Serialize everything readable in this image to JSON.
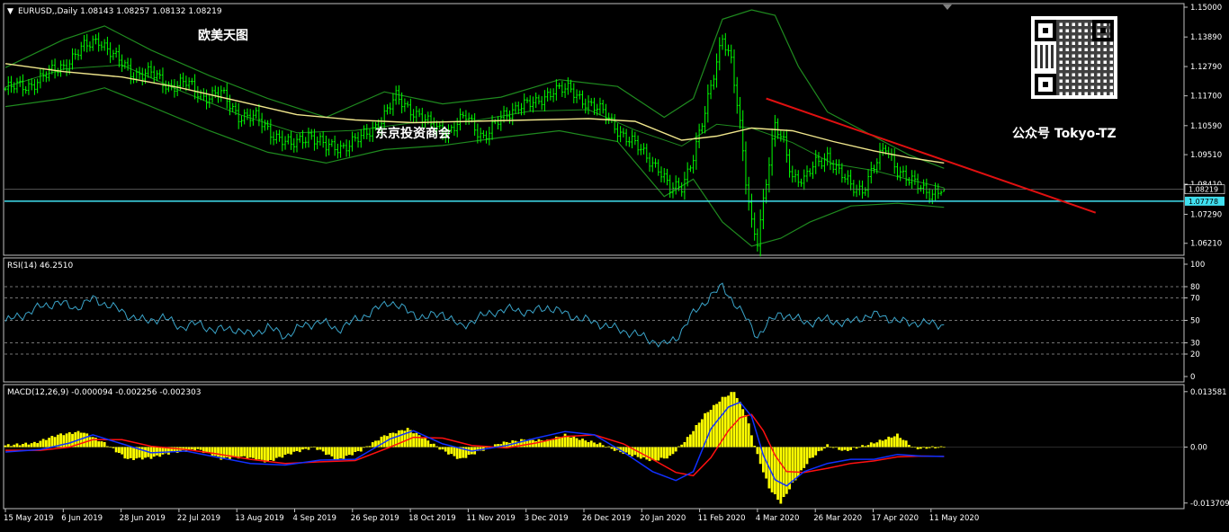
{
  "header": {
    "symbol_line": "EURUSD,,Daily  1.08143 1.08257 1.08132 1.08219"
  },
  "watermarks": {
    "top_left": "欧美天图",
    "middle": "东京投资商会",
    "right": "公众号 Tokyo-TZ"
  },
  "colors": {
    "background": "#000000",
    "candle": "#00ff00",
    "bollinger": "#1f8a1f",
    "ma": "#f0e68c",
    "trendline": "#e01010",
    "support": "#40e0f0",
    "rsi": "#3aa3c8",
    "macd_hist": "#ffff00",
    "macd_line": "#1030ff",
    "signal_line": "#ff1010",
    "grid": "#c0c0c0"
  },
  "chart_data": [
    {
      "type": "candlestick",
      "title": "EURUSD,,Daily",
      "ohlc_last": {
        "open": 1.08143,
        "high": 1.08257,
        "low": 1.08132,
        "close": 1.08219
      },
      "price_ticks": [
        "1.15000",
        "1.13890",
        "1.12790",
        "1.11700",
        "1.10590",
        "1.09510",
        "1.08410",
        "1.07290",
        "1.06210"
      ],
      "ylim": [
        1.058,
        1.151
      ],
      "current_price": "1.08219",
      "support_level": "1.07778",
      "overlays": [
        "Bollinger Bands",
        "Moving Average",
        "Trendline",
        "Horizontal line"
      ],
      "x_dates": [
        "15 May 2019",
        "6 Jun 2019",
        "28 Jun 2019",
        "22 Jul 2019",
        "13 Aug 2019",
        "4 Sep 2019",
        "26 Sep 2019",
        "18 Oct 2019",
        "11 Nov 2019",
        "3 Dec 2019",
        "26 Dec 2019",
        "20 Jan 2020",
        "11 Feb 2020",
        "4 Mar 2020",
        "26 Mar 2020",
        "17 Apr 2020",
        "11 May 2020"
      ],
      "close_path": [
        [
          0,
          1.1195
        ],
        [
          8,
          1.121
        ],
        [
          14,
          1.1245
        ],
        [
          20,
          1.1285
        ],
        [
          26,
          1.134
        ],
        [
          32,
          1.1385
        ],
        [
          38,
          1.1305
        ],
        [
          44,
          1.1255
        ],
        [
          50,
          1.125
        ],
        [
          56,
          1.121
        ],
        [
          62,
          1.1215
        ],
        [
          68,
          1.117
        ],
        [
          74,
          1.1175
        ],
        [
          80,
          1.11
        ],
        [
          86,
          1.1085
        ],
        [
          92,
          1.103
        ],
        [
          98,
          1.098
        ],
        [
          104,
          1.103
        ],
        [
          110,
          1.0975
        ],
        [
          116,
          1.0985
        ],
        [
          122,
          1.101
        ],
        [
          128,
          1.107
        ],
        [
          134,
          1.116
        ],
        [
          140,
          1.1115
        ],
        [
          146,
          1.1055
        ],
        [
          152,
          1.104
        ],
        [
          158,
          1.109
        ],
        [
          164,
          1.102
        ],
        [
          170,
          1.108
        ],
        [
          176,
          1.114
        ],
        [
          182,
          1.1135
        ],
        [
          188,
          1.12
        ],
        [
          194,
          1.1185
        ],
        [
          200,
          1.1145
        ],
        [
          206,
          1.1095
        ],
        [
          212,
          1.1025
        ],
        [
          218,
          1.0965
        ],
        [
          224,
          1.0905
        ],
        [
          228,
          1.0815
        ],
        [
          232,
          1.0835
        ],
        [
          236,
          1.095
        ],
        [
          240,
          1.11
        ],
        [
          243,
          1.125
        ],
        [
          246,
          1.14
        ],
        [
          249,
          1.13
        ],
        [
          252,
          1.105
        ],
        [
          254,
          1.085
        ],
        [
          256,
          1.07
        ],
        [
          258,
          1.064
        ],
        [
          261,
          1.085
        ],
        [
          264,
          1.105
        ],
        [
          267,
          1.1
        ],
        [
          270,
          1.0875
        ],
        [
          274,
          1.085
        ],
        [
          278,
          1.092
        ],
        [
          282,
          1.095
        ],
        [
          286,
          1.088
        ],
        [
          290,
          1.0835
        ],
        [
          294,
          1.0825
        ],
        [
          298,
          1.09
        ],
        [
          302,
          1.098
        ],
        [
          306,
          1.09
        ],
        [
          310,
          1.085
        ],
        [
          314,
          1.083
        ],
        [
          318,
          1.081
        ],
        [
          322,
          1.0822
        ]
      ],
      "bands_upper_path": [
        [
          0,
          1.1275
        ],
        [
          20,
          1.138
        ],
        [
          34,
          1.143
        ],
        [
          50,
          1.134
        ],
        [
          70,
          1.1245
        ],
        [
          90,
          1.116
        ],
        [
          110,
          1.109
        ],
        [
          130,
          1.1185
        ],
        [
          150,
          1.114
        ],
        [
          170,
          1.1165
        ],
        [
          190,
          1.123
        ],
        [
          210,
          1.1205
        ],
        [
          226,
          1.109
        ],
        [
          236,
          1.116
        ],
        [
          246,
          1.1455
        ],
        [
          256,
          1.149
        ],
        [
          264,
          1.147
        ],
        [
          272,
          1.128
        ],
        [
          282,
          1.111
        ],
        [
          296,
          1.103
        ],
        [
          310,
          1.095
        ],
        [
          322,
          1.09
        ]
      ],
      "bands_lower_path": [
        [
          0,
          1.113
        ],
        [
          20,
          1.116
        ],
        [
          34,
          1.12
        ],
        [
          50,
          1.113
        ],
        [
          70,
          1.104
        ],
        [
          90,
          1.096
        ],
        [
          110,
          1.092
        ],
        [
          130,
          1.097
        ],
        [
          150,
          1.0985
        ],
        [
          170,
          1.1015
        ],
        [
          190,
          1.104
        ],
        [
          210,
          1.1
        ],
        [
          226,
          1.0795
        ],
        [
          236,
          1.086
        ],
        [
          246,
          1.07
        ],
        [
          256,
          1.061
        ],
        [
          266,
          1.064
        ],
        [
          276,
          1.07
        ],
        [
          290,
          1.076
        ],
        [
          306,
          1.077
        ],
        [
          322,
          1.0755
        ]
      ],
      "ma_path": [
        [
          0,
          1.129
        ],
        [
          20,
          1.126
        ],
        [
          40,
          1.124
        ],
        [
          60,
          1.12
        ],
        [
          80,
          1.115
        ],
        [
          100,
          1.11
        ],
        [
          120,
          1.108
        ],
        [
          140,
          1.107
        ],
        [
          160,
          1.1075
        ],
        [
          180,
          1.108
        ],
        [
          200,
          1.1085
        ],
        [
          216,
          1.1075
        ],
        [
          232,
          1.1005
        ],
        [
          244,
          1.102
        ],
        [
          256,
          1.105
        ],
        [
          270,
          1.104
        ],
        [
          284,
          1.1
        ],
        [
          298,
          1.0965
        ],
        [
          310,
          1.094
        ],
        [
          322,
          1.092
        ]
      ],
      "trendline": [
        [
          261,
          1.116
        ],
        [
          374,
          1.0735
        ]
      ]
    },
    {
      "type": "line",
      "title": "RSI(14) 46.2510",
      "indicator": "RSI(14)",
      "last_value": 46.251,
      "ylim": [
        0,
        100
      ],
      "levels": [
        20,
        30,
        50,
        70,
        80
      ],
      "tick_labels": [
        "100",
        "80",
        "70",
        "50",
        "30",
        "20",
        "0"
      ],
      "values": [
        [
          0,
          49
        ],
        [
          6,
          55
        ],
        [
          12,
          62
        ],
        [
          18,
          66
        ],
        [
          24,
          61
        ],
        [
          30,
          69
        ],
        [
          36,
          63
        ],
        [
          42,
          55
        ],
        [
          48,
          49
        ],
        [
          54,
          53
        ],
        [
          60,
          44
        ],
        [
          66,
          47
        ],
        [
          72,
          41
        ],
        [
          78,
          43
        ],
        [
          84,
          37
        ],
        [
          90,
          44
        ],
        [
          96,
          36
        ],
        [
          102,
          45
        ],
        [
          108,
          49
        ],
        [
          114,
          42
        ],
        [
          120,
          50
        ],
        [
          126,
          58
        ],
        [
          132,
          67
        ],
        [
          138,
          58
        ],
        [
          144,
          52
        ],
        [
          150,
          57
        ],
        [
          156,
          44
        ],
        [
          162,
          52
        ],
        [
          168,
          58
        ],
        [
          174,
          60
        ],
        [
          180,
          57
        ],
        [
          186,
          62
        ],
        [
          192,
          56
        ],
        [
          198,
          51
        ],
        [
          204,
          47
        ],
        [
          210,
          42
        ],
        [
          216,
          38
        ],
        [
          222,
          32
        ],
        [
          226,
          28
        ],
        [
          230,
          34
        ],
        [
          236,
          56
        ],
        [
          242,
          72
        ],
        [
          246,
          80
        ],
        [
          250,
          66
        ],
        [
          254,
          52
        ],
        [
          258,
          36
        ],
        [
          262,
          48
        ],
        [
          266,
          57
        ],
        [
          270,
          52
        ],
        [
          276,
          48
        ],
        [
          282,
          51
        ],
        [
          288,
          47
        ],
        [
          294,
          53
        ],
        [
          300,
          55
        ],
        [
          306,
          49
        ],
        [
          312,
          48
        ],
        [
          318,
          47
        ],
        [
          322,
          46.3
        ]
      ]
    },
    {
      "type": "bar+line",
      "title": "MACD(12,26,9) -0.000094 -0.002256 -0.002303",
      "indicator": "MACD(12,26,9)",
      "last_values": {
        "histogram": -9.4e-05,
        "macd": -0.002256,
        "signal": -0.002303
      },
      "ylim": [
        -0.0142,
        0.0142
      ],
      "tick_labels": [
        "0.013581",
        "0.00",
        "-0.013709"
      ],
      "histogram_path": [
        [
          0,
          0.0004
        ],
        [
          10,
          0.001
        ],
        [
          18,
          0.003
        ],
        [
          26,
          0.0038
        ],
        [
          34,
          0.001
        ],
        [
          42,
          -0.003
        ],
        [
          50,
          -0.0026
        ],
        [
          58,
          -0.0012
        ],
        [
          66,
          -0.0006
        ],
        [
          74,
          -0.0028
        ],
        [
          82,
          -0.0024
        ],
        [
          90,
          -0.0036
        ],
        [
          98,
          -0.0015
        ],
        [
          106,
          0.0
        ],
        [
          114,
          -0.0032
        ],
        [
          122,
          -0.0008
        ],
        [
          130,
          0.0028
        ],
        [
          138,
          0.0045
        ],
        [
          144,
          0.002
        ],
        [
          150,
          -0.0008
        ],
        [
          156,
          -0.003
        ],
        [
          162,
          -0.0012
        ],
        [
          170,
          0.001
        ],
        [
          178,
          0.0018
        ],
        [
          186,
          0.0016
        ],
        [
          192,
          0.003
        ],
        [
          198,
          0.0018
        ],
        [
          204,
          0.0008
        ],
        [
          210,
          -0.001
        ],
        [
          216,
          -0.0022
        ],
        [
          222,
          -0.0034
        ],
        [
          228,
          -0.0024
        ],
        [
          234,
          0.0022
        ],
        [
          240,
          0.008
        ],
        [
          246,
          0.012
        ],
        [
          250,
          0.0136
        ],
        [
          254,
          0.008
        ],
        [
          258,
          -0.002
        ],
        [
          262,
          -0.01
        ],
        [
          266,
          -0.0137
        ],
        [
          270,
          -0.009
        ],
        [
          276,
          -0.003
        ],
        [
          282,
          0.0004
        ],
        [
          288,
          -0.001
        ],
        [
          294,
          0.0002
        ],
        [
          300,
          0.0015
        ],
        [
          306,
          0.003
        ],
        [
          312,
          -0.0004
        ],
        [
          318,
          -0.0001
        ],
        [
          322,
          -0.0001
        ]
      ],
      "macd_path": [
        [
          0,
          -0.0012
        ],
        [
          12,
          -0.0006
        ],
        [
          22,
          0.001
        ],
        [
          30,
          0.003
        ],
        [
          40,
          0.0008
        ],
        [
          50,
          -0.0014
        ],
        [
          62,
          -0.001
        ],
        [
          72,
          -0.0024
        ],
        [
          84,
          -0.004
        ],
        [
          96,
          -0.0044
        ],
        [
          108,
          -0.0032
        ],
        [
          120,
          -0.003
        ],
        [
          132,
          0.002
        ],
        [
          140,
          0.004
        ],
        [
          150,
          0.0008
        ],
        [
          160,
          -0.001
        ],
        [
          172,
          0.0004
        ],
        [
          182,
          0.0022
        ],
        [
          192,
          0.0038
        ],
        [
          202,
          0.003
        ],
        [
          212,
          -0.0012
        ],
        [
          222,
          -0.006
        ],
        [
          230,
          -0.0082
        ],
        [
          236,
          -0.006
        ],
        [
          242,
          0.0045
        ],
        [
          248,
          0.0098
        ],
        [
          252,
          0.011
        ],
        [
          256,
          0.0075
        ],
        [
          260,
          -0.002
        ],
        [
          264,
          -0.008
        ],
        [
          268,
          -0.0095
        ],
        [
          274,
          -0.006
        ],
        [
          282,
          -0.004
        ],
        [
          290,
          -0.003
        ],
        [
          298,
          -0.003
        ],
        [
          306,
          -0.0018
        ],
        [
          314,
          -0.0022
        ],
        [
          322,
          -0.0023
        ]
      ],
      "signal_path": [
        [
          0,
          -0.0008
        ],
        [
          12,
          -0.0008
        ],
        [
          22,
          0.0
        ],
        [
          30,
          0.0018
        ],
        [
          40,
          0.0018
        ],
        [
          50,
          0.0002
        ],
        [
          62,
          -0.0006
        ],
        [
          72,
          -0.0016
        ],
        [
          84,
          -0.003
        ],
        [
          96,
          -0.004
        ],
        [
          108,
          -0.0036
        ],
        [
          120,
          -0.0033
        ],
        [
          132,
          0.0
        ],
        [
          140,
          0.0024
        ],
        [
          150,
          0.0022
        ],
        [
          160,
          0.0004
        ],
        [
          172,
          -0.0002
        ],
        [
          182,
          0.001
        ],
        [
          192,
          0.0026
        ],
        [
          202,
          0.003
        ],
        [
          212,
          0.0008
        ],
        [
          222,
          -0.003
        ],
        [
          230,
          -0.0062
        ],
        [
          236,
          -0.007
        ],
        [
          242,
          -0.0026
        ],
        [
          248,
          0.004
        ],
        [
          252,
          0.0072
        ],
        [
          256,
          0.008
        ],
        [
          260,
          0.004
        ],
        [
          264,
          -0.002
        ],
        [
          268,
          -0.006
        ],
        [
          274,
          -0.0062
        ],
        [
          282,
          -0.0052
        ],
        [
          290,
          -0.004
        ],
        [
          298,
          -0.0034
        ],
        [
          306,
          -0.0024
        ],
        [
          314,
          -0.0022
        ],
        [
          322,
          -0.0023
        ]
      ]
    }
  ]
}
